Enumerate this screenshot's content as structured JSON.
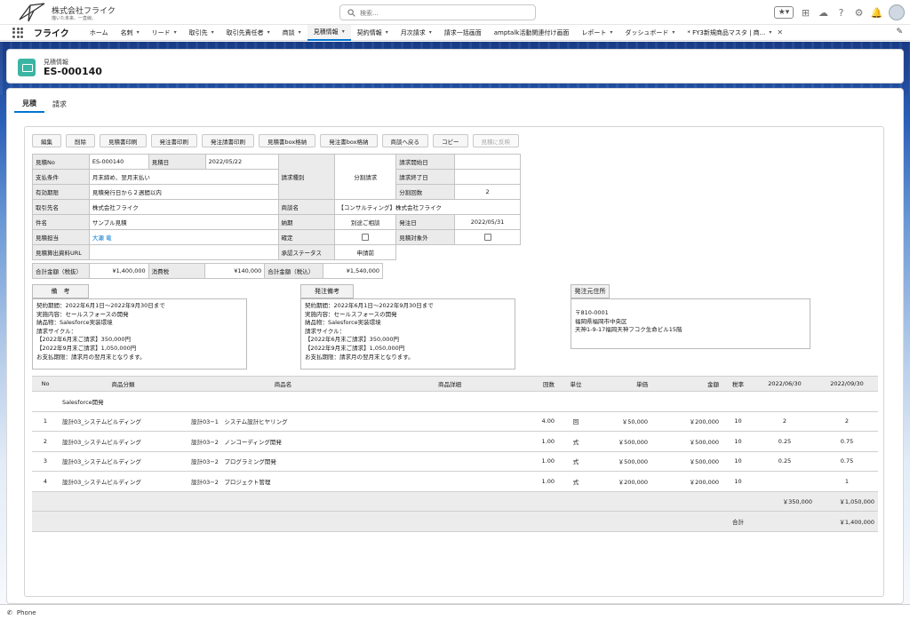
{
  "header": {
    "company_name": "株式会社フライク",
    "company_tagline": "描いた未来、一直線。",
    "search_placeholder": "検索..."
  },
  "nav": {
    "app_name": "フライク",
    "tabs": [
      {
        "label": "ホーム",
        "chevron": false
      },
      {
        "label": "名刺",
        "chevron": true
      },
      {
        "label": "リード",
        "chevron": true
      },
      {
        "label": "取引先",
        "chevron": true
      },
      {
        "label": "取引先責任者",
        "chevron": true
      },
      {
        "label": "商談",
        "chevron": true
      },
      {
        "label": "見積情報",
        "chevron": true,
        "active": true
      },
      {
        "label": "契約情報",
        "chevron": true
      },
      {
        "label": "月次請求",
        "chevron": true
      },
      {
        "label": "請求一括画面",
        "chevron": false
      },
      {
        "label": "amptalk活動関連付け画面",
        "chevron": false
      },
      {
        "label": "レポート",
        "chevron": true
      },
      {
        "label": "ダッシュボード",
        "chevron": true
      },
      {
        "label": "* FY3新規商品マスタ | 商...",
        "chevron": true,
        "closable": true
      }
    ]
  },
  "record": {
    "object_label": "見積情報",
    "name": "ES-000140"
  },
  "subtabs": [
    "見積",
    "請求"
  ],
  "buttons": [
    {
      "label": "編集"
    },
    {
      "label": "削除"
    },
    {
      "label": "見積書印刷"
    },
    {
      "label": "発注書印刷"
    },
    {
      "label": "発注請書印刷"
    },
    {
      "label": "見積書box格納"
    },
    {
      "label": "発注書box格納"
    },
    {
      "label": "商談へ戻る"
    },
    {
      "label": "コピー"
    },
    {
      "label": "見積に反映",
      "disabled": true
    }
  ],
  "fields": {
    "quote_no_label": "見積No",
    "quote_no": "ES-000140",
    "quote_date_label": "見積日",
    "quote_date": "2022/05/22",
    "billing_type_label": "請求種別",
    "billing_type": "分割請求",
    "billing_start_label": "請求開始日",
    "billing_start": "",
    "billing_end_label": "請求終了日",
    "billing_end": "",
    "installments_label": "分割回数",
    "installments": "2",
    "payment_terms_label": "支払条件",
    "payment_terms": "月末締め、翌月末払い",
    "validity_label": "有効期限",
    "validity": "見積発行日から２週間以内",
    "account_label": "取引先名",
    "account": "株式会社フライク",
    "opportunity_label": "商談名",
    "opportunity": "【コンサルティング】株式会社フライク",
    "subject_label": "件名",
    "subject": "サンプル見積",
    "delivery_label": "納期",
    "delivery": "別途ご相談",
    "order_date_label": "発注日",
    "order_date": "2022/05/31",
    "owner_label": "見積担当",
    "owner": "大瀬 竜",
    "confirmed_label": "確定",
    "excluded_label": "見積対象外",
    "calc_url_label": "見積算出資料URL",
    "calc_url": "",
    "approval_label": "承認ステータス",
    "approval": "申請前"
  },
  "totals": {
    "ex_tax_label": "合計金額（税抜）",
    "ex_tax": "¥1,400,000",
    "tax_label": "消費税",
    "tax": "¥140,000",
    "inc_tax_label": "合計金額（税込）",
    "inc_tax": "¥1,540,000"
  },
  "notes": {
    "remarks_label": "備　考",
    "remarks": "契約期間：2022年6月1日～2022年9月30日まで\n実施内容：セールスフォースの開発\n納品物：Salesforce実装環境\n請求サイクル：\n【2022年6月末ご請求】350,000円\n【2022年9月末ご請求】1,050,000円\nお支払期限：請求月の翌月末となります。",
    "order_remarks_label": "発注備考",
    "order_remarks": "契約期間：2022年6月1日～2022年9月30日まで\n実施内容：セールスフォースの開発\n納品物：Salesforce実装環境\n請求サイクル：\n【2022年6月末ご請求】350,000円\n【2022年9月末ご請求】1,050,000円\nお支払期限：請求月の翌月末となります。",
    "order_address_label": "発注元住所",
    "order_address": "〒810-0001\n福岡県福岡市中央区\n天神1-9-17福岡天神フコク生命ビル15階"
  },
  "items": {
    "columns": [
      "No",
      "商品分類",
      "商品名",
      "商品詳細",
      "回数",
      "単位",
      "単価",
      "金額",
      "税率",
      "2022/06/30",
      "2022/09/30"
    ],
    "group": "Salesforce開発",
    "rows": [
      [
        "1",
        "設計03_システムビルディング",
        "設計03−1　システム設計ヒヤリング",
        "",
        "4.00",
        "回",
        "￥50,000",
        "￥200,000",
        "10",
        "2",
        "2"
      ],
      [
        "2",
        "設計03_システムビルディング",
        "設計03−2　ノンコーディング開発",
        "",
        "1.00",
        "式",
        "￥500,000",
        "￥500,000",
        "10",
        "0.25",
        "0.75"
      ],
      [
        "3",
        "設計03_システムビルディング",
        "設計03−2　プログラミング開発",
        "",
        "1.00",
        "式",
        "￥500,000",
        "￥500,000",
        "10",
        "0.25",
        "0.75"
      ],
      [
        "4",
        "設計03_システムビルディング",
        "設計03−2　プロジェクト管理",
        "",
        "1.00",
        "式",
        "￥200,000",
        "￥200,000",
        "10",
        "",
        "1"
      ]
    ],
    "period_totals": [
      "￥350,000",
      "￥1,050,000"
    ],
    "grand_total_label": "合計",
    "grand_total": "￥1,400,000"
  },
  "footer": {
    "phone_label": "Phone"
  }
}
